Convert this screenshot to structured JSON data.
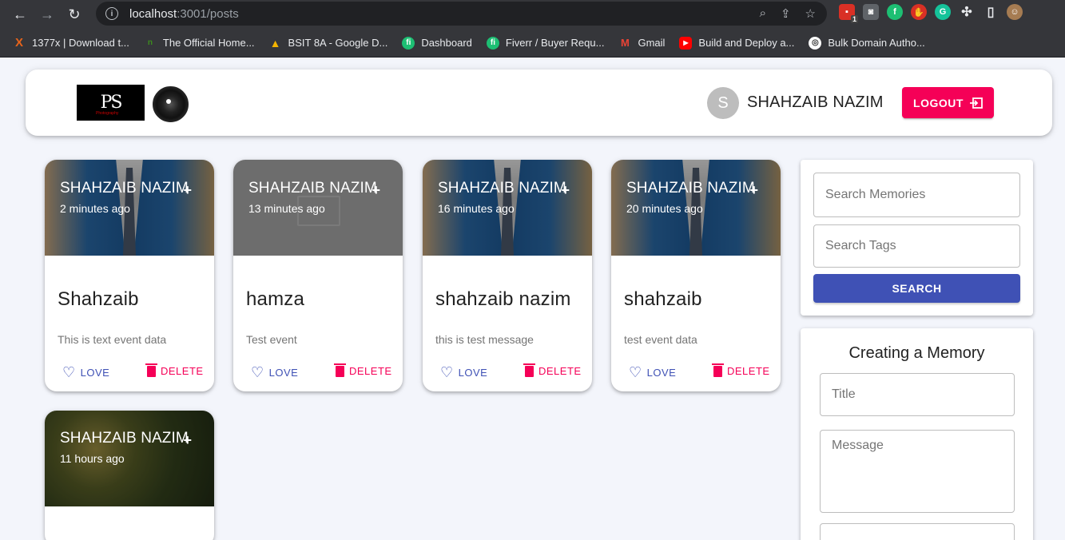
{
  "browser": {
    "url_host": "localhost",
    "url_path": ":3001/posts",
    "ext_badge": "1",
    "bookmarks": [
      {
        "label": "1377x | Download t...",
        "icon": "X",
        "color": "#e8641b"
      },
      {
        "label": "The Official Home...",
        "icon": "n",
        "color": "#3c8b1e"
      },
      {
        "label": "BSIT 8A - Google D...",
        "icon": "▲",
        "color": "#1a73e8"
      },
      {
        "label": "Dashboard",
        "icon": "fi",
        "color": "#1dbf73"
      },
      {
        "label": "Fiverr / Buyer Requ...",
        "icon": "fi",
        "color": "#1dbf73"
      },
      {
        "label": "Gmail",
        "icon": "M",
        "color": "#ea4335"
      },
      {
        "label": "Build and Deploy a...",
        "icon": "▶",
        "color": "#ff0000"
      },
      {
        "label": "Bulk Domain Autho...",
        "icon": "◎",
        "color": "#555555"
      }
    ]
  },
  "header": {
    "logo_text": "PS",
    "logo_tagline": "Photography",
    "avatar_letter": "S",
    "username": "SHAHZAIB NAZIM",
    "logout_label": "LOGOUT"
  },
  "posts": [
    {
      "creator": "SHAHZAIB NAZIM",
      "time": "2 minutes ago",
      "title": "Shahzaib",
      "message": "This is text event data",
      "love_label": "LOVE",
      "delete_label": "DELETE",
      "more": "+"
    },
    {
      "creator": "SHAHZAIB NAZIM",
      "time": "13 minutes ago",
      "title": "hamza",
      "message": "Test event",
      "love_label": "LOVE",
      "delete_label": "DELETE",
      "more": "+"
    },
    {
      "creator": "SHAHZAIB NAZIM",
      "time": "16 minutes ago",
      "title": "shahzaib nazim",
      "message": "this is test message",
      "love_label": "LOVE",
      "delete_label": "DELETE",
      "more": "+"
    },
    {
      "creator": "SHAHZAIB NAZIM",
      "time": "20 minutes ago",
      "title": "shahzaib",
      "message": "test event data",
      "love_label": "LOVE",
      "delete_label": "DELETE",
      "more": "+"
    },
    {
      "creator": "SHAHZAIB NAZIM",
      "time": "11 hours ago",
      "more": "+"
    }
  ],
  "search": {
    "memories_placeholder": "Search Memories",
    "tags_placeholder": "Search Tags",
    "button_label": "SEARCH"
  },
  "form": {
    "title": "Creating a Memory",
    "title_placeholder": "Title",
    "message_placeholder": "Message"
  }
}
